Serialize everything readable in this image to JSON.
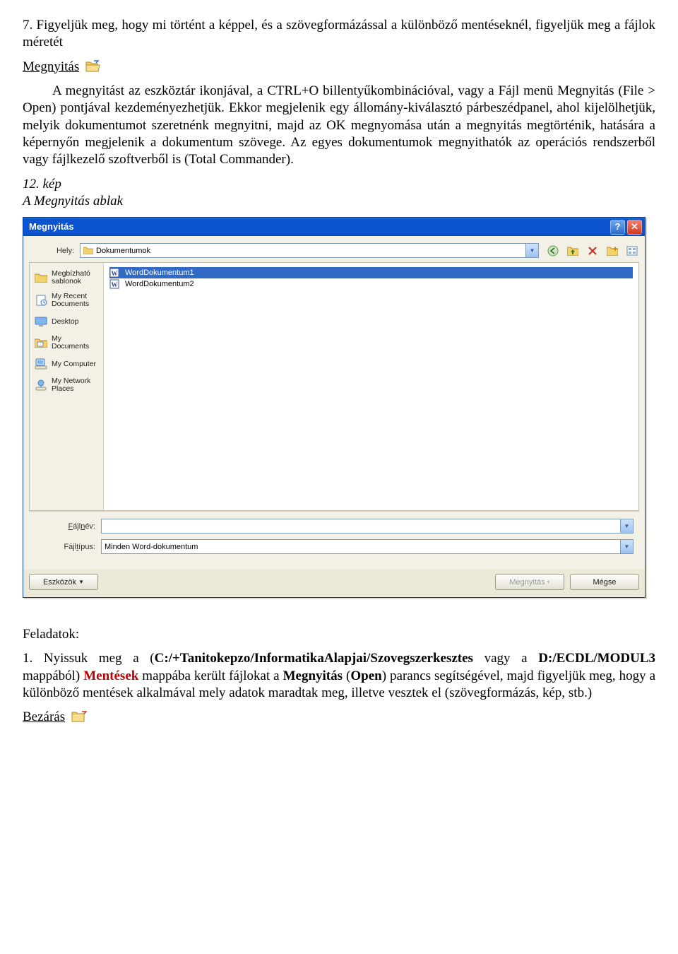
{
  "doc": {
    "task7": "7. Figyeljük meg, hogy mi történt a képpel, és a szövegformázással a különböző mentéseknél, figyeljük meg a fájlok méretét",
    "open_heading": "Megnyitás",
    "open_body": "A megnyitást az eszköztár ikonjával, a CTRL+O billentyűkombinációval, vagy a Fájl menü Megnyitás (File > Open) pontjával kezdeményezhetjük. Ekkor megjelenik egy állomány-kiválasztó párbeszédpanel, ahol kijelölhetjük, melyik dokumentumot szeretnénk megnyitni, majd az OK megnyomása után a megnyitás megtörténik, hatására a képernyőn megjelenik a dokumentum szövege. Az egyes dokumentumok megnyithatók az operációs rendszerből vagy fájlkezelő szoftverből is (Total Commander).",
    "fig_num": "12. kép",
    "fig_caption": "A Megnyitás ablak",
    "feladatok": "Feladatok:",
    "task1_a": "1. Nyissuk meg a (",
    "task1_path1": "C:/+Tanitokepzo/InformatikaAlapjai/Szovegszerkesztes",
    "task1_b": " vagy a ",
    "task1_path2": "D:/ECDL/MODUL3",
    "task1_c": " mappából) ",
    "task1_d": "Mentések",
    "task1_e": " mappába került fájlokat a ",
    "task1_f": "Megnyitás",
    "task1_g": " (",
    "task1_h": "Open",
    "task1_i": ") parancs segítségével, majd figyeljük meg, hogy a különböző mentések alkalmával mely adatok maradtak meg, illetve vesztek el (szövegformázás, kép, stb.)",
    "close_heading": "Bezárás"
  },
  "dlg": {
    "title": "Megnyitás",
    "help": "?",
    "close": "✕",
    "loc_label": "Hely:",
    "loc_value": "Dokumentumok",
    "places": [
      {
        "label": "Megbízható sablonok",
        "icon": "folder"
      },
      {
        "label": "My Recent Documents",
        "icon": "recent"
      },
      {
        "label": "Desktop",
        "icon": "desktop"
      },
      {
        "label": "My Documents",
        "icon": "mydocs"
      },
      {
        "label": "My Computer",
        "icon": "computer"
      },
      {
        "label": "My Network Places",
        "icon": "network"
      }
    ],
    "files": [
      {
        "name": "WordDokumentum1",
        "selected": true
      },
      {
        "name": "WordDokumentum2",
        "selected": false
      }
    ],
    "filename_label": "Fájlnév:",
    "filetype_label": "Fájltípus:",
    "filetype_value": "Minden Word-dokumentum",
    "tools_btn": "Eszközök",
    "open_btn": "Megnyitás",
    "cancel_btn": "Mégse"
  }
}
